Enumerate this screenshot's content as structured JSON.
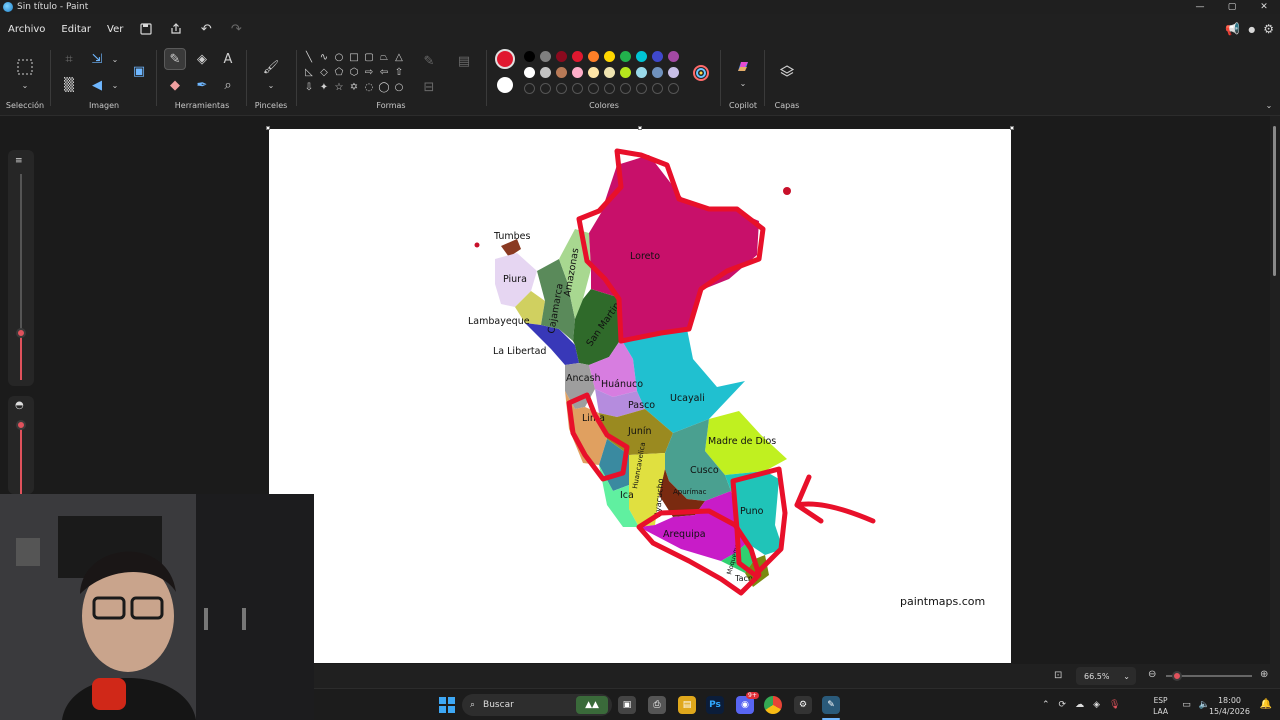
{
  "window": {
    "title": "Sin título - Paint",
    "minimize": "—",
    "maximize": "▢",
    "close": "✕"
  },
  "menu": {
    "file": "Archivo",
    "edit": "Editar",
    "view": "Ver"
  },
  "ribbon": {
    "groups": {
      "selection": "Selección",
      "image": "Imagen",
      "tools": "Herramientas",
      "brushes": "Pinceles",
      "shapes": "Formas",
      "colors": "Colores",
      "copilot": "Copilot",
      "layers": "Capas"
    },
    "colors": {
      "primary": "#e0182f",
      "secondary": "#ffffff",
      "row1": [
        "#000000",
        "#7f7f7f",
        "#8b0a1e",
        "#e0182f",
        "#ff7f27",
        "#ffd700",
        "#22b14c",
        "#00c4d4",
        "#3f48cc",
        "#a349a4"
      ],
      "row2": [
        "#ffffff",
        "#c3c3c3",
        "#b97a57",
        "#ffaec9",
        "#ffe6a8",
        "#efe4b0",
        "#b5e61d",
        "#99d9ea",
        "#7092be",
        "#c8bfe7"
      ]
    }
  },
  "map": {
    "regions": {
      "tumbes": "Tumbes",
      "piura": "Piura",
      "lambayeque": "Lambayeque",
      "la_libertad": "La Libertad",
      "cajamarca": "Cajamarca",
      "amazonas": "Amazonas",
      "loreto": "Loreto",
      "san_martin": "San Martin",
      "ancash": "Ancash",
      "huanuco": "Huánuco",
      "pasco": "Pasco",
      "ucayali": "Ucayali",
      "lima": "Lima",
      "junin": "Junín",
      "madre_de_dios": "Madre de Dios",
      "cusco": "Cusco",
      "huancavelica": "Huancavelica",
      "ayacucho": "Ayacucho",
      "apurimac": "Apurímac",
      "ica": "Ica",
      "puno": "Puno",
      "arequipa": "Arequipa",
      "moquegua": "Moquegua",
      "tacna": "Tacna"
    },
    "credit": "paintmaps.com"
  },
  "status": {
    "zoom": "66.5%"
  },
  "taskbar": {
    "search": "Buscar",
    "lang_top": "ESP",
    "lang_bottom": "LAA",
    "time": "18:00",
    "date": "15/4/2026",
    "discord_badge": "9+"
  }
}
